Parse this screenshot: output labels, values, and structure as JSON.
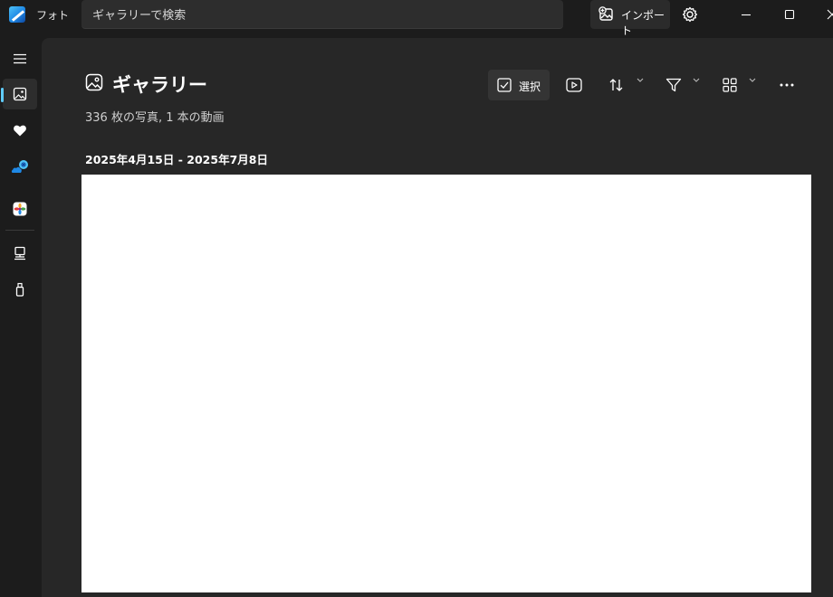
{
  "app": {
    "title": "フォト"
  },
  "search": {
    "placeholder": "ギャラリーで検索"
  },
  "titlebar": {
    "import_label": "インポート"
  },
  "icons": {
    "app": "photos-app-icon",
    "import": "image-add-icon",
    "settings": "gear-icon",
    "minimize": "minimize-icon",
    "maximize": "maximize-icon",
    "close": "close-icon",
    "menu": "hamburger-menu-icon",
    "gallery": "image-icon",
    "favorites": "heart-icon",
    "onedrive": "onedrive-cloud-icon",
    "icloud": "icloud-photos-icon",
    "this_pc": "computer-icon",
    "external": "usb-drive-icon",
    "select": "checkbox-icon",
    "slideshow": "play-icon",
    "sort": "sort-arrows-icon",
    "filter": "filter-icon",
    "view": "grid-view-icon",
    "more": "more-ellipsis-icon"
  },
  "page": {
    "title": "ギャラリー",
    "subtitle": "336 枚の写真, 1 本の動画",
    "date_range": "2025年4月15日 - 2025年7月8日"
  },
  "toolbar": {
    "select_label": "選択"
  },
  "colors": {
    "accent": "#60cdff",
    "window_bg": "#1c1c1c",
    "panel_bg": "#272727",
    "favorites": "#ffffff"
  }
}
